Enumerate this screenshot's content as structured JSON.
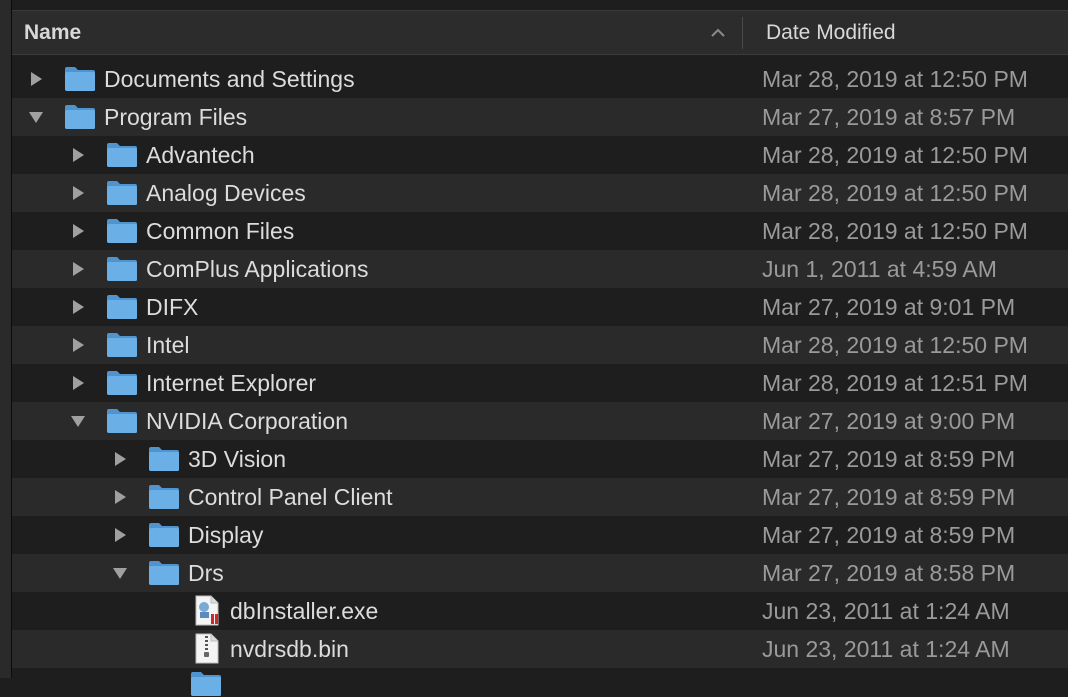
{
  "header": {
    "name_label": "Name",
    "date_label": "Date Modified",
    "sort_icon": "chevron-up-icon"
  },
  "colors": {
    "folder": "#6ab0e6",
    "folder_tab": "#4f94cf",
    "row_alt": "#2a2a2a",
    "row_base": "#1e1e1e",
    "date_text": "#9a9a9a"
  },
  "rows": [
    {
      "name": "Documents and Settings",
      "date": "Mar 28, 2019 at 12:50 PM",
      "level": 0,
      "kind": "folder",
      "expanded": false
    },
    {
      "name": "Program Files",
      "date": "Mar 27, 2019 at 8:57 PM",
      "level": 0,
      "kind": "folder",
      "expanded": true
    },
    {
      "name": "Advantech",
      "date": "Mar 28, 2019 at 12:50 PM",
      "level": 1,
      "kind": "folder",
      "expanded": false
    },
    {
      "name": "Analog Devices",
      "date": "Mar 28, 2019 at 12:50 PM",
      "level": 1,
      "kind": "folder",
      "expanded": false
    },
    {
      "name": "Common Files",
      "date": "Mar 28, 2019 at 12:50 PM",
      "level": 1,
      "kind": "folder",
      "expanded": false
    },
    {
      "name": "ComPlus Applications",
      "date": "Jun 1, 2011 at 4:59 AM",
      "level": 1,
      "kind": "folder",
      "expanded": false
    },
    {
      "name": "DIFX",
      "date": "Mar 27, 2019 at 9:01 PM",
      "level": 1,
      "kind": "folder",
      "expanded": false
    },
    {
      "name": "Intel",
      "date": "Mar 28, 2019 at 12:50 PM",
      "level": 1,
      "kind": "folder",
      "expanded": false
    },
    {
      "name": "Internet Explorer",
      "date": "Mar 28, 2019 at 12:51 PM",
      "level": 1,
      "kind": "folder",
      "expanded": false
    },
    {
      "name": "NVIDIA Corporation",
      "date": "Mar 27, 2019 at 9:00 PM",
      "level": 1,
      "kind": "folder",
      "expanded": true
    },
    {
      "name": "3D Vision",
      "date": "Mar 27, 2019 at 8:59 PM",
      "level": 2,
      "kind": "folder",
      "expanded": false
    },
    {
      "name": "Control Panel Client",
      "date": "Mar 27, 2019 at 8:59 PM",
      "level": 2,
      "kind": "folder",
      "expanded": false
    },
    {
      "name": "Display",
      "date": "Mar 27, 2019 at 8:59 PM",
      "level": 2,
      "kind": "folder",
      "expanded": false
    },
    {
      "name": "Drs",
      "date": "Mar 27, 2019 at 8:58 PM",
      "level": 2,
      "kind": "folder",
      "expanded": true
    },
    {
      "name": "dbInstaller.exe",
      "date": "Jun 23, 2011 at 1:24 AM",
      "level": 3,
      "kind": "exe"
    },
    {
      "name": "nvdrsdb.bin",
      "date": "Jun 23, 2011 at 1:24 AM",
      "level": 3,
      "kind": "file"
    }
  ]
}
